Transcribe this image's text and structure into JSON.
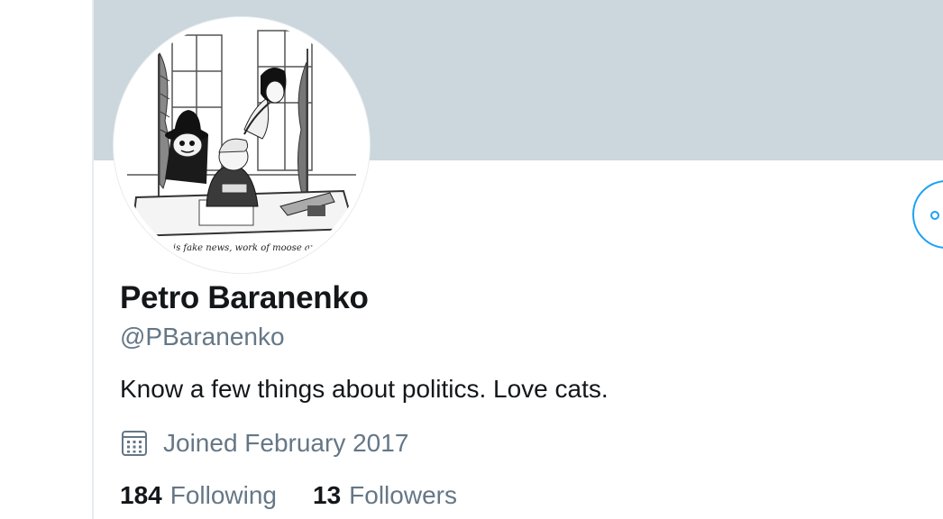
{
  "profile": {
    "display_name": "Petro Baranenko",
    "handle": "@PBaranenko",
    "bio": "Know a few things about politics. Love cats.",
    "joined": "Joined February 2017",
    "avatar_caption": "m is fake news, work of moose and"
  },
  "stats": {
    "following_count": "184",
    "following_label": "Following",
    "followers_count": "13",
    "followers_label": "Followers"
  },
  "colors": {
    "banner": "#ccd6dd",
    "accent": "#1da1f2",
    "secondary_text": "#657786",
    "primary_text": "#14171a"
  },
  "icons": {
    "joined": "calendar-icon",
    "follow": "follow-circle-icon"
  }
}
